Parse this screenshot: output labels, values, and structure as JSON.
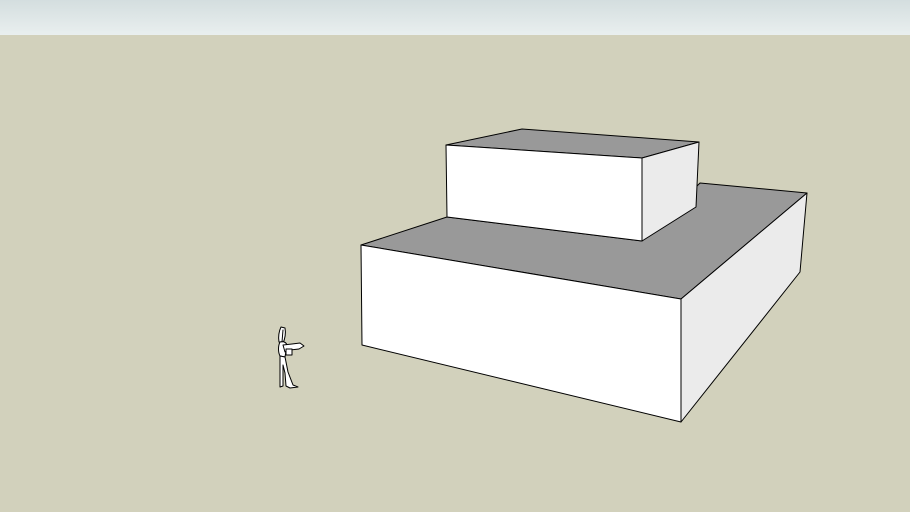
{
  "scene": {
    "sky_color": "#dfe7e8",
    "ground_color": "#d2d1bc",
    "face_front_color": "#ffffff",
    "face_top_color": "#999999",
    "face_side_color": "#ebebeb",
    "edge_color": "#000000",
    "objects": [
      "lower-box",
      "upper-box",
      "person-figure"
    ]
  }
}
